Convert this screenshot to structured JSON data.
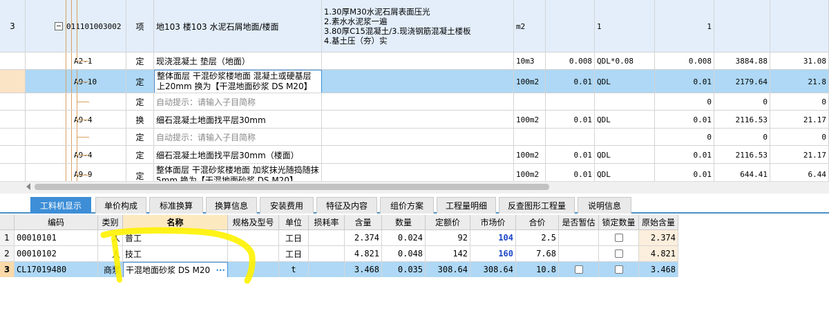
{
  "upper_rows": [
    {
      "num": "3",
      "code": "011101003002",
      "type": "项",
      "name": "地103 楼103 水泥石屑地面/楼面",
      "feature": [
        "1.30厚M30水泥石屑表面压光",
        "2.素水水泥浆一遍",
        "3.80厚C15混凝土/3.现浇钢筋混凝土楼板",
        "4.基土压（夯）实"
      ],
      "unit": "m2",
      "qty": "",
      "expr": "1",
      "total": "1",
      "price": "",
      "sum": ""
    },
    {
      "num": "",
      "code": "A2-1",
      "type": "定",
      "name": "现浇混凝土 垫层（地面）",
      "feature": [],
      "unit": "10m3",
      "qty": "0.008",
      "expr": "QDL*0.08",
      "total": "0.008",
      "price": "3884.88",
      "sum": "31.08"
    },
    {
      "num": "",
      "code": "A9-10",
      "type": "定",
      "name": "整体面层 干混砂浆楼地面 混凝土或硬基层上20mm  换为【干混地面砂浆 DS M20】",
      "feature": [],
      "unit": "100m2",
      "qty": "0.01",
      "expr": "QDL",
      "total": "0.01",
      "price": "2179.64",
      "sum": "21.8"
    },
    {
      "num": "",
      "code": "",
      "type": "定",
      "name": "自动提示：请输入子目简称",
      "feature": [],
      "unit": "",
      "qty": "",
      "expr": "",
      "total": "0",
      "price": "0",
      "sum": "0"
    },
    {
      "num": "",
      "code": "A9-4",
      "type": "换",
      "name": "细石混凝土地面找平层30mm",
      "feature": [],
      "unit": "100m2",
      "qty": "0.01",
      "expr": "QDL",
      "total": "0.01",
      "price": "2116.53",
      "sum": "21.17"
    },
    {
      "num": "",
      "code": "",
      "type": "定",
      "name": "自动提示：请输入子目简称",
      "feature": [],
      "unit": "",
      "qty": "",
      "expr": "",
      "total": "0",
      "price": "0",
      "sum": "0"
    },
    {
      "num": "",
      "code": "A9-4",
      "type": "定",
      "name": "细石混凝土地面找平层30mm（楼面）",
      "feature": [],
      "unit": "100m2",
      "qty": "0.01",
      "expr": "QDL",
      "total": "0.01",
      "price": "2116.53",
      "sum": "21.17"
    },
    {
      "num": "",
      "code": "A9-9",
      "type": "定",
      "name": "整体面层 干混砂浆楼地面 加浆抹光随捣随抹5mm  换为【干混地面砂浆 DS M20】",
      "feature": [],
      "unit": "100m2",
      "qty": "0.01",
      "expr": "QDL",
      "total": "0.01",
      "price": "644.41",
      "sum": "6.44"
    }
  ],
  "tabs": [
    "工料机显示",
    "单价构成",
    "标准换算",
    "换算信息",
    "安装费用",
    "特征及内容",
    "组价方案",
    "工程量明细",
    "反查图形工程量",
    "说明信息"
  ],
  "lower_headers": [
    "",
    "编码",
    "类别",
    "名称",
    "规格及型号",
    "单位",
    "损耗率",
    "含量",
    "数量",
    "定额价",
    "市场价",
    "合价",
    "是否暂估",
    "锁定数量",
    "原始含量"
  ],
  "lower_rows": [
    {
      "idx": "1",
      "code": "00010101",
      "cat": "人",
      "name": "普工",
      "spec": "",
      "unit": "工日",
      "loss": "",
      "content": "2.374",
      "qty": "0.024",
      "base": "92",
      "market": "104",
      "sum": "2.5",
      "orig": "2.374"
    },
    {
      "idx": "2",
      "code": "00010102",
      "cat": "人",
      "name": "技工",
      "spec": "",
      "unit": "工日",
      "loss": "",
      "content": "4.821",
      "qty": "0.048",
      "base": "142",
      "market": "160",
      "sum": "7.68",
      "orig": "4.821"
    },
    {
      "idx": "3",
      "code": "CL17019480",
      "cat": "商浆",
      "name": "干混地面砂浆 DS M20",
      "spec": "",
      "unit": "t",
      "loss": "",
      "content": "3.468",
      "qty": "0.035",
      "base": "308.64",
      "market": "308.64",
      "sum": "10.8",
      "orig": "3.468"
    }
  ],
  "ellipsis_label": "···",
  "icons": {
    "collapse": "minus-box-icon",
    "checkbox": "checkbox-icon"
  },
  "colors": {
    "selected_row": "#aed8f5",
    "active_tab": "#3d8ed6",
    "annotation": "#ffee00"
  }
}
